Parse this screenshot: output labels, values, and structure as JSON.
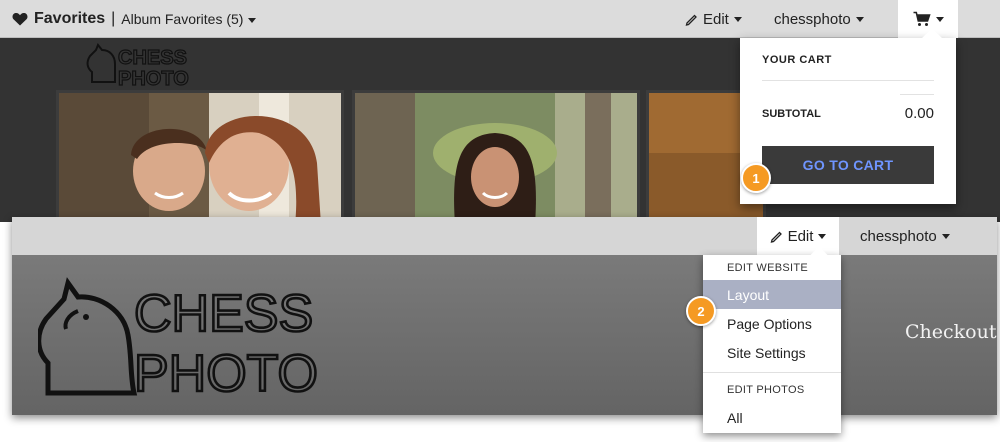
{
  "top": {
    "favorites_label": "Favorites",
    "separator": "|",
    "album_select": "Album Favorites (5)",
    "edit_label": "Edit",
    "user_label": "chessphoto",
    "logo_line1": "CHESS",
    "logo_line2": "PHOTO",
    "cart": {
      "title": "YOUR CART",
      "subtotal_label": "SUBTOTAL",
      "subtotal_value": "0.00",
      "button_label": "GO TO CART"
    },
    "badge": "1"
  },
  "bottom": {
    "edit_label": "Edit",
    "user_label": "chessphoto",
    "logo_line1": "CHESS",
    "logo_line2": "PHOTO",
    "checkout_label": "Checkout",
    "menu": {
      "section1": "EDIT WEBSITE",
      "items1": [
        "Layout",
        "Page Options",
        "Site Settings"
      ],
      "section2": "EDIT PHOTOS",
      "items2": [
        "All"
      ]
    },
    "badge": "2"
  },
  "icons": {
    "favorites": "heart-icon",
    "edit": "pencil-icon",
    "cart": "shopping-cart-icon",
    "dropdown": "caret-down-icon"
  },
  "colors": {
    "cart_button_text": "#6f95ff",
    "badge": "#f59a23",
    "menu_active": "#aab0c4"
  }
}
